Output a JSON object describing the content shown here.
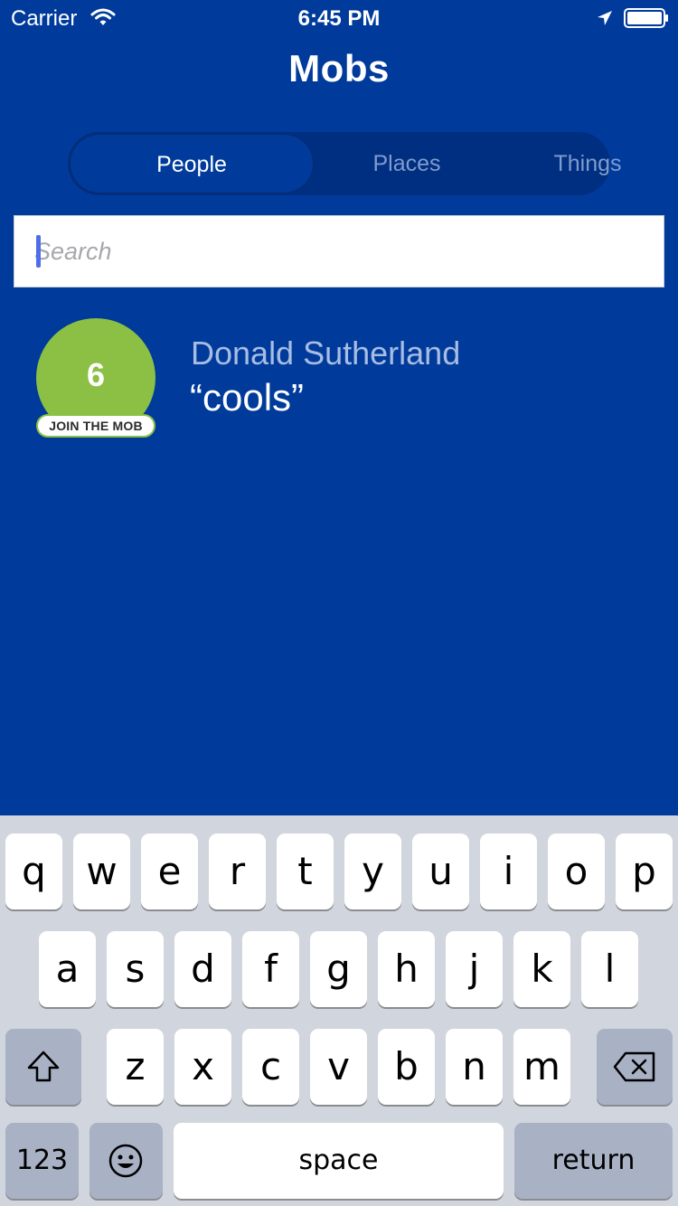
{
  "status_bar": {
    "carrier": "Carrier",
    "time": "6:45 PM"
  },
  "header": {
    "title": "Mobs"
  },
  "segments": [
    {
      "label": "People",
      "active": true
    },
    {
      "label": "Places",
      "active": false
    },
    {
      "label": "Things",
      "active": false
    }
  ],
  "search": {
    "placeholder": "Search",
    "value": ""
  },
  "mobs": [
    {
      "count": "6",
      "join_label": "JOIN THE MOB",
      "name": "Donald Sutherland",
      "quote": "“cools”"
    }
  ],
  "keyboard": {
    "row1": [
      "q",
      "w",
      "e",
      "r",
      "t",
      "y",
      "u",
      "i",
      "o",
      "p"
    ],
    "row2": [
      "a",
      "s",
      "d",
      "f",
      "g",
      "h",
      "j",
      "k",
      "l"
    ],
    "row3": [
      "z",
      "x",
      "c",
      "v",
      "b",
      "n",
      "m"
    ],
    "numbers_label": "123",
    "space_label": "space",
    "return_label": "return",
    "icons": {
      "shift": "shift-icon",
      "delete": "delete-icon",
      "emoji": "emoji-icon"
    }
  },
  "colors": {
    "background": "#003b9b",
    "accent_green": "#8cc044",
    "segment_track": "#002e80"
  }
}
